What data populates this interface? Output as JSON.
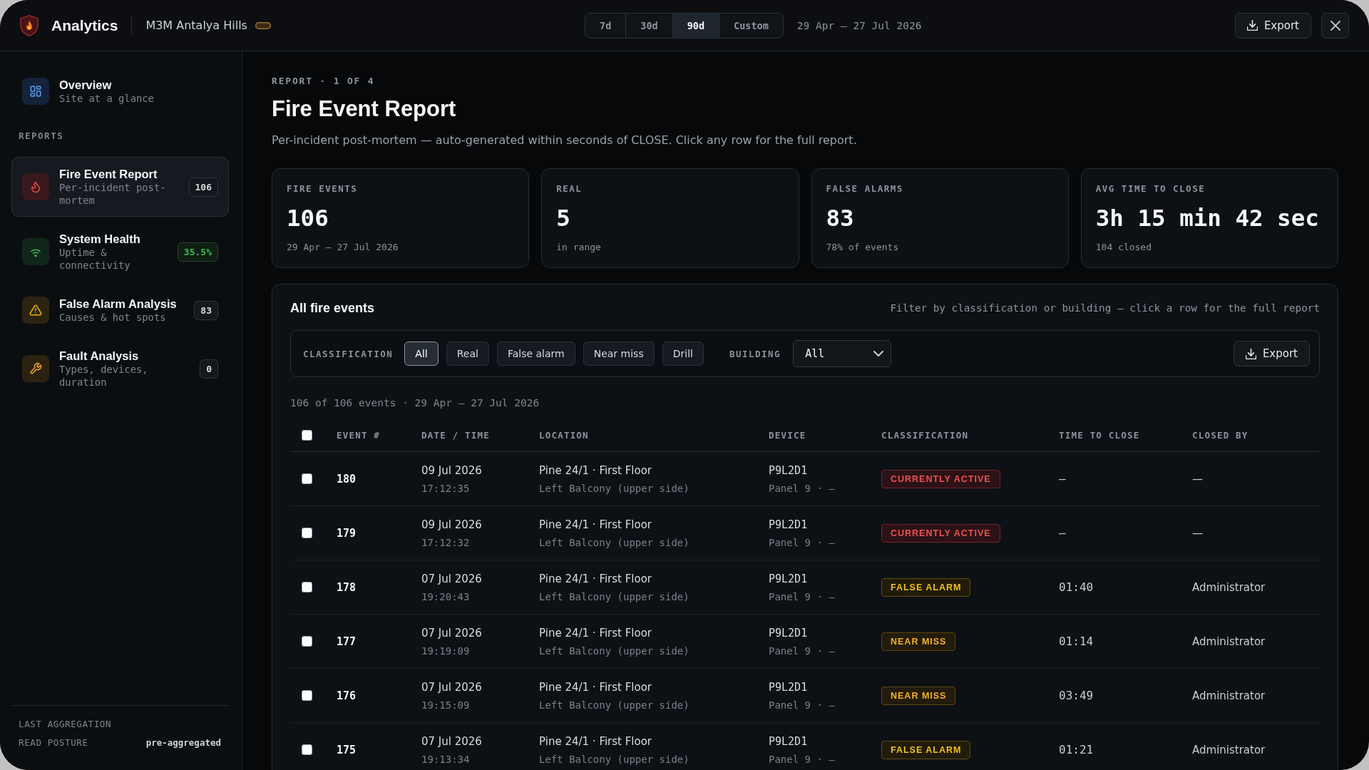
{
  "app_bar": {
    "title": "Analytics",
    "site": "M3M Antalya Hills",
    "range_options": [
      {
        "label": "7d",
        "selected": false
      },
      {
        "label": "30d",
        "selected": false
      },
      {
        "label": "90d",
        "selected": true
      },
      {
        "label": "Custom",
        "selected": false
      }
    ],
    "date_range": "29 Apr — 27 Jul 2026",
    "export_label": "Export"
  },
  "sidebar": {
    "overview": {
      "kind": "overview",
      "title": "Overview",
      "subtitle": "Site at a glance",
      "selected": false
    },
    "section_label": "REPORTS",
    "items": [
      {
        "kind": "fire",
        "title": "Fire Event Report",
        "subtitle": "Per-incident post-mortem",
        "badge": "106",
        "badge_highlighted": false,
        "selected": true
      },
      {
        "kind": "health",
        "title": "System Health",
        "subtitle": "Uptime & connectivity",
        "badge": "35.5%",
        "badge_highlighted": true,
        "selected": false
      },
      {
        "kind": "false_alarm",
        "title": "False Alarm Analysis",
        "subtitle": "Causes & hot spots",
        "badge": "83",
        "badge_highlighted": false,
        "selected": false
      },
      {
        "kind": "fault",
        "title": "Fault Analysis",
        "subtitle": "Types, devices, duration",
        "badge": "0",
        "badge_highlighted": false,
        "selected": false
      }
    ],
    "footer": [
      {
        "label": "LAST AGGREGATION"
      },
      {
        "label": "READ POSTURE",
        "value": "pre-aggregated"
      }
    ]
  },
  "report": {
    "eyebrow": "REPORT · 1 OF 4",
    "title": "Fire Event Report",
    "description": "Per-incident post-mortem — auto-generated within seconds of CLOSE. Click any row for the full report.",
    "stats": [
      {
        "label": "FIRE EVENTS",
        "value": "106",
        "note": "29 Apr — 27 Jul 2026"
      },
      {
        "label": "REAL",
        "value": "5",
        "note": "in range"
      },
      {
        "label": "FALSE ALARMS",
        "value": "83",
        "note": "78% of events"
      },
      {
        "label": "AVG TIME TO CLOSE",
        "value": "3h 15 min 42 sec",
        "note": "104 closed"
      }
    ]
  },
  "events": {
    "title": "All fire events",
    "hint": "Filter by classification or building — click a row for the full report",
    "classification_filter": {
      "label": "CLASSIFICATION",
      "options": [
        {
          "label": "All",
          "selected": true
        },
        {
          "label": "Real",
          "selected": false
        },
        {
          "label": "False alarm",
          "selected": false
        },
        {
          "label": "Near miss",
          "selected": false
        },
        {
          "label": "Drill",
          "selected": false
        }
      ]
    },
    "building_filter": {
      "label": "BUILDING",
      "value": "All"
    },
    "export_label": "Export",
    "count_text": "106 of 106 events · 29 Apr — 27 Jul 2026",
    "table": {
      "select_all_checked": false,
      "columns": [
        "EVENT #",
        "DATE / TIME",
        "LOCATION",
        "DEVICE",
        "CLASSIFICATION",
        "TIME TO CLOSE",
        "CLOSED BY"
      ],
      "rows": [
        {
          "checked": false,
          "event": "180",
          "date": "09 Jul 2026",
          "time": "17:12:35",
          "location": "Pine 24/1 · First Floor",
          "location_detail": "Left Balcony (upper side)",
          "device": "P9L2D1",
          "device_detail": "Panel 9 · —",
          "classification": {
            "label": "CURRENTLY ACTIVE",
            "kind": "active"
          },
          "time_to_close": "–",
          "closed_by": "—"
        },
        {
          "checked": false,
          "event": "179",
          "date": "09 Jul 2026",
          "time": "17:12:32",
          "location": "Pine 24/1 · First Floor",
          "location_detail": "Left Balcony (upper side)",
          "device": "P9L2D1",
          "device_detail": "Panel 9 · —",
          "classification": {
            "label": "CURRENTLY ACTIVE",
            "kind": "active"
          },
          "time_to_close": "–",
          "closed_by": "—"
        },
        {
          "checked": false,
          "event": "178",
          "date": "07 Jul 2026",
          "time": "19:20:43",
          "location": "Pine 24/1 · First Floor",
          "location_detail": "Left Balcony (upper side)",
          "device": "P9L2D1",
          "device_detail": "Panel 9 · —",
          "classification": {
            "label": "FALSE ALARM",
            "kind": "false_alarm"
          },
          "time_to_close": "01:40",
          "closed_by": "Administrator"
        },
        {
          "checked": false,
          "event": "177",
          "date": "07 Jul 2026",
          "time": "19:19:09",
          "location": "Pine 24/1 · First Floor",
          "location_detail": "Left Balcony (upper side)",
          "device": "P9L2D1",
          "device_detail": "Panel 9 · —",
          "classification": {
            "label": "NEAR MISS",
            "kind": "near_miss"
          },
          "time_to_close": "01:14",
          "closed_by": "Administrator"
        },
        {
          "checked": false,
          "event": "176",
          "date": "07 Jul 2026",
          "time": "19:15:09",
          "location": "Pine 24/1 · First Floor",
          "location_detail": "Left Balcony (upper side)",
          "device": "P9L2D1",
          "device_detail": "Panel 9 · —",
          "classification": {
            "label": "NEAR MISS",
            "kind": "near_miss"
          },
          "time_to_close": "03:49",
          "closed_by": "Administrator"
        },
        {
          "checked": false,
          "event": "175",
          "date": "07 Jul 2026",
          "time": "19:13:34",
          "location": "Pine 24/1 · First Floor",
          "location_detail": "Left Balcony (upper side)",
          "device": "P9L2D1",
          "device_detail": "Panel 9 · —",
          "classification": {
            "label": "FALSE ALARM",
            "kind": "false_alarm"
          },
          "time_to_close": "01:21",
          "closed_by": "Administrator"
        }
      ]
    }
  }
}
